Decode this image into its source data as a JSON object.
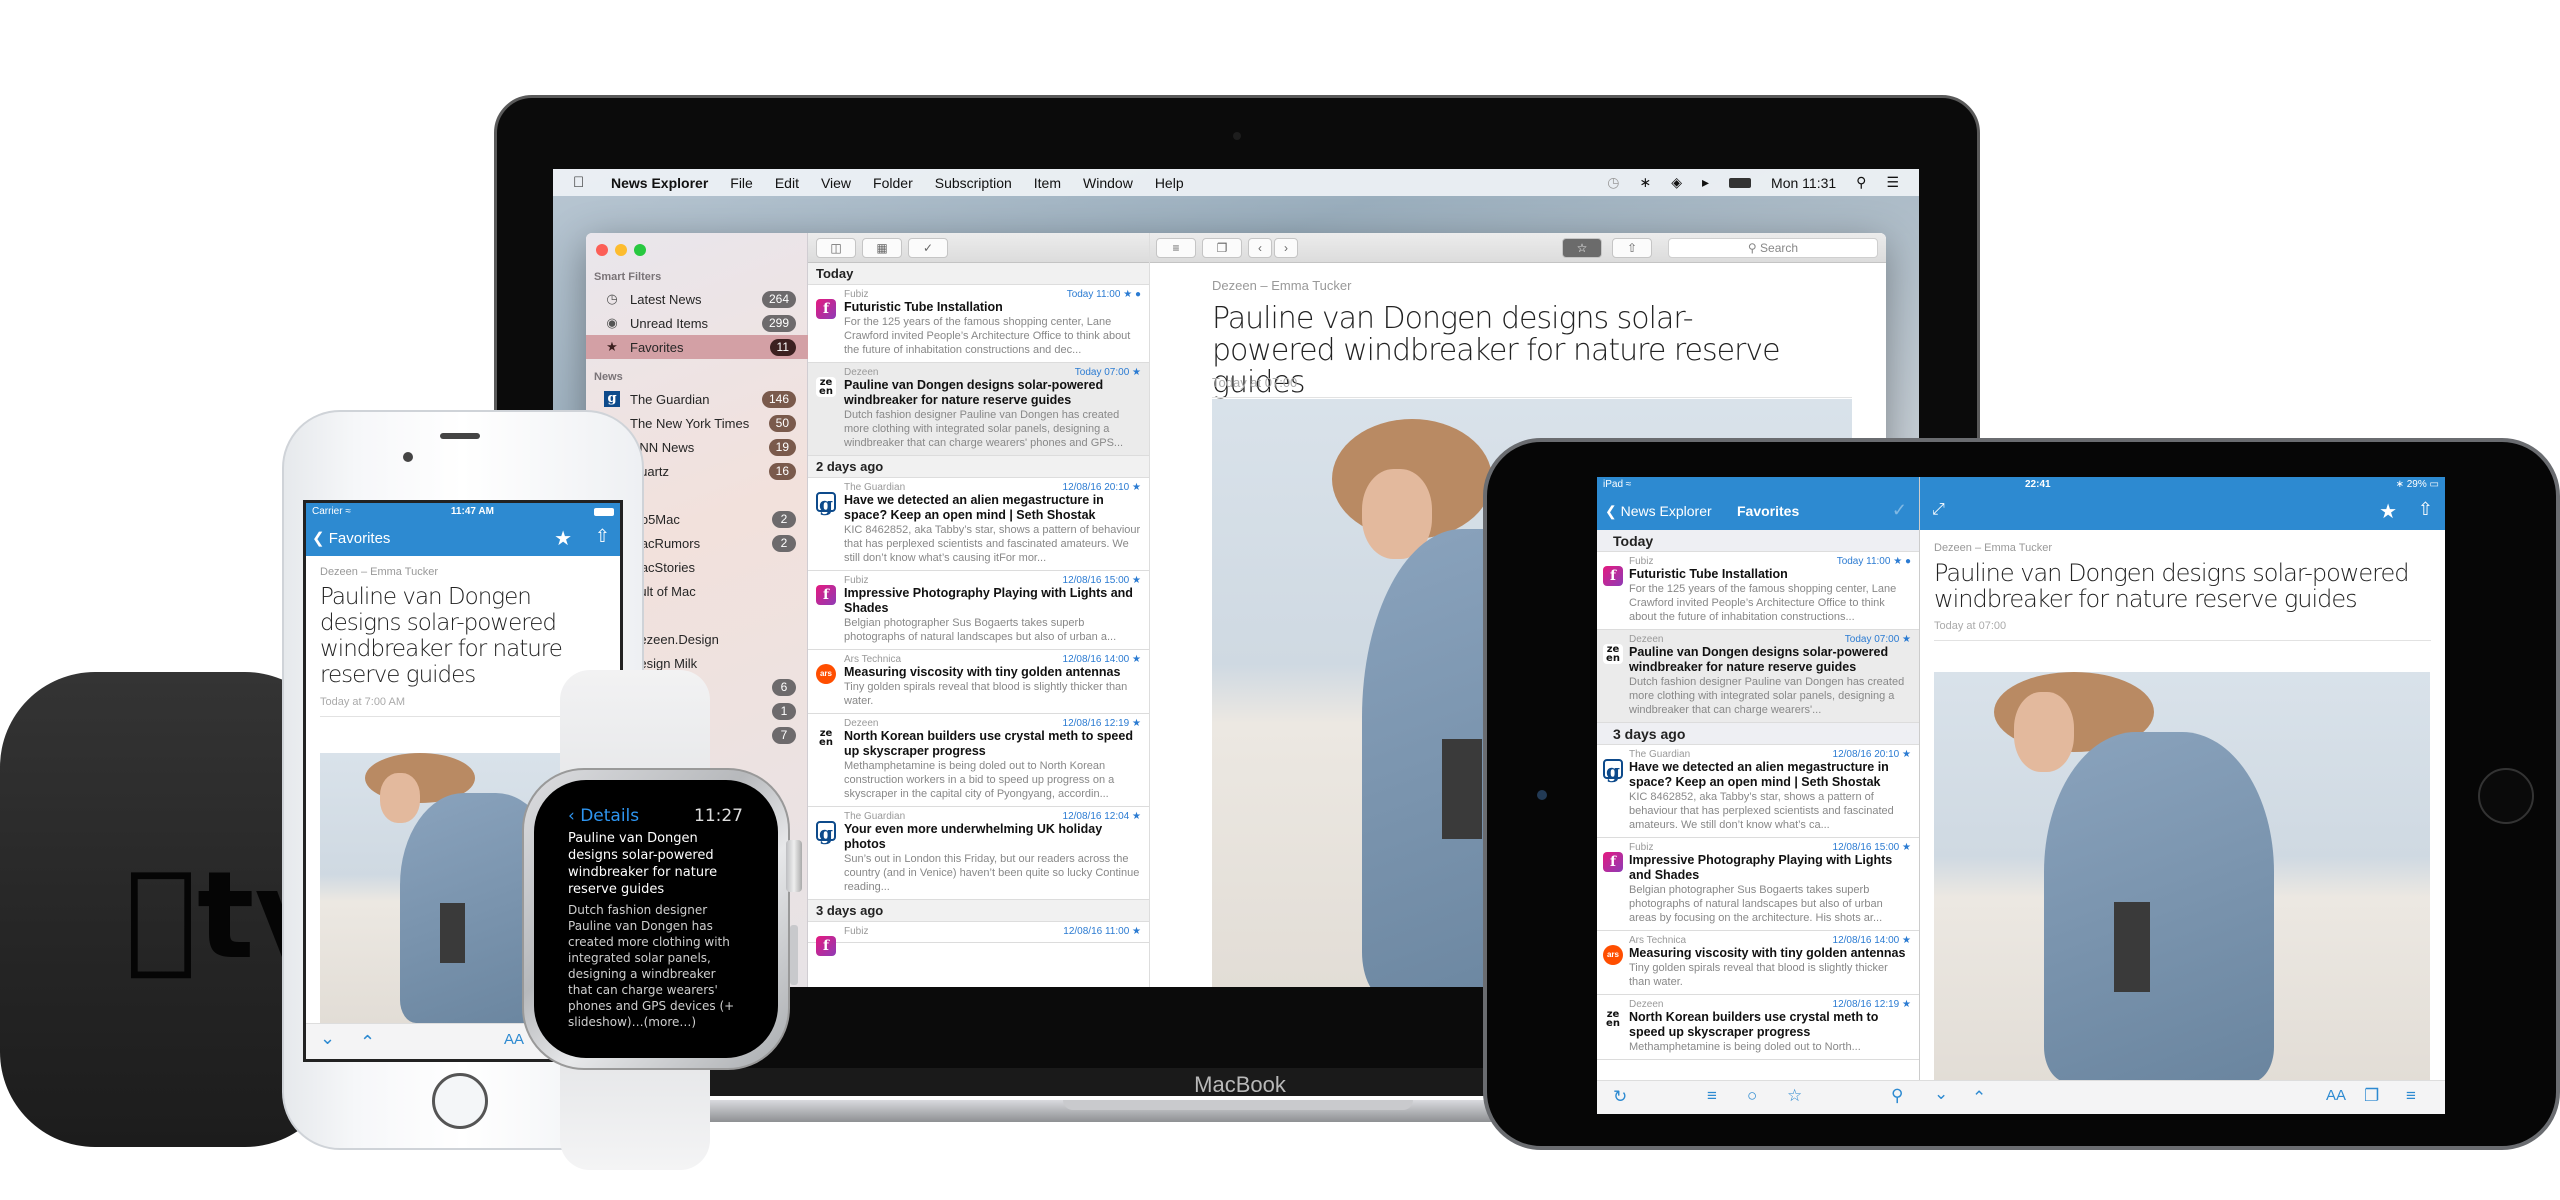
{
  "devices": {
    "apple_tv": {
      "logo_text": "tv"
    },
    "macbook": {
      "label": "MacBook"
    }
  },
  "mac": {
    "menubar": {
      "apple_icon": "apple-icon",
      "app_name": "News Explorer",
      "menus": [
        "File",
        "Edit",
        "View",
        "Folder",
        "Subscription",
        "Item",
        "Window",
        "Help"
      ],
      "status_icons": [
        "time-machine-icon",
        "bluetooth-icon",
        "wifi-icon",
        "volume-icon",
        "battery-icon"
      ],
      "clock": "Mon 11:31",
      "spotlight_icon": "search-icon",
      "notification_icon": "list-icon"
    },
    "sidebar": {
      "smart_filters_header": "Smart Filters",
      "smart_filters": [
        {
          "label": "Latest News",
          "count": "264",
          "icon": "clock-icon"
        },
        {
          "label": "Unread Items",
          "count": "299",
          "icon": "unread-icon"
        },
        {
          "label": "Favorites",
          "count": "11",
          "icon": "star-icon",
          "selected": true
        }
      ],
      "news_header": "News",
      "feeds": [
        {
          "label": "The Guardian",
          "count": "146"
        },
        {
          "label": "The New York Times",
          "count": "50"
        },
        {
          "label": "CNN News",
          "count": "19"
        },
        {
          "label": "Quartz",
          "count": "16"
        }
      ],
      "more_feeds": [
        {
          "label": "9to5Mac",
          "count": "2"
        },
        {
          "label": "MacRumors",
          "count": "2"
        },
        {
          "label": "MacStories",
          "count": ""
        },
        {
          "label": "Cult of Mac",
          "count": ""
        },
        {
          "label": "",
          "count": ""
        },
        {
          "label": "Dezeen.Design",
          "count": ""
        },
        {
          "label": "Design Milk",
          "count": ""
        },
        {
          "label": "",
          "count": "6"
        },
        {
          "label": "",
          "count": "1"
        },
        {
          "label": "",
          "count": "7"
        }
      ]
    },
    "list": {
      "sections": [
        {
          "title": "Today",
          "articles": [
            {
              "source": "Fubiz",
              "date": "Today 11:00 ★ ●",
              "title": "Futuristic Tube Installation",
              "summary": "For the 125 years of the famous shopping center, Lane Crawford invited People’s Architecture Office to think about the future of inhabitation constructions and dec...",
              "fav": "fubiz"
            },
            {
              "source": "Dezeen",
              "date": "Today 07:00 ★",
              "title": "Pauline van Dongen designs solar-powered windbreaker for nature reserve guides",
              "summary": "Dutch fashion designer Pauline van Dongen has created more clothing with integrated solar panels, designing a windbreaker that can charge wearers' phones and GPS...",
              "fav": "dezeen",
              "selected": true
            }
          ]
        },
        {
          "title": "2 days ago",
          "articles": [
            {
              "source": "The Guardian",
              "date": "12/08/16 20:10 ★",
              "title": "Have we detected an alien megastructure in space? Keep an open mind | Seth Shostak",
              "summary": "KIC 8462852, aka Tabby’s star, shows a pattern of behaviour that has perplexed scientists and fascinated amateurs. We still don’t know what’s causing itFor mor...",
              "fav": "guardian"
            },
            {
              "source": "Fubiz",
              "date": "12/08/16 15:00 ★",
              "title": "Impressive Photography Playing with Lights and Shades",
              "summary": "Belgian photographer Sus Bogaerts takes superb photographs of natural landscapes but also of urban a...",
              "fav": "fubiz"
            },
            {
              "source": "Ars Technica",
              "date": "12/08/16 14:00 ★",
              "title": "Measuring viscosity with tiny golden antennas",
              "summary": "Tiny golden spirals reveal that blood is slightly thicker than water.",
              "fav": "ars"
            },
            {
              "source": "Dezeen",
              "date": "12/08/16 12:19 ★",
              "title": "North Korean builders use crystal meth to speed up skyscraper progress",
              "summary": "Methamphetamine is being doled out to North Korean construction workers in a bid to speed up progress on a skyscraper in the capital city of Pyongyang, accordin...",
              "fav": "dezeen"
            },
            {
              "source": "The Guardian",
              "date": "12/08/16 12:04 ★",
              "title": "Your even more underwhelming UK holiday photos",
              "summary": "Sun’s out in London this Friday, but our readers across the country (and in Venice) haven’t been quite so lucky Continue reading...",
              "fav": "guardian"
            }
          ]
        },
        {
          "title": "3 days ago",
          "articles": [
            {
              "source": "Fubiz",
              "date": "12/08/16 11:00 ★",
              "title": "",
              "summary": "",
              "fav": "fubiz"
            }
          ]
        }
      ]
    },
    "reader": {
      "search_placeholder": "Search",
      "source": "Dezeen – Emma Tucker",
      "title": "Pauline van Dongen designs solar-powered windbreaker for nature reserve guides",
      "date": "Today at 07:00"
    }
  },
  "iphone": {
    "carrier": "Carrier",
    "time": "11:47 AM",
    "back_label": "Favorites",
    "source": "Dezeen – Emma Tucker",
    "title": "Pauline van Dongen designs solar-powered windbreaker for nature reserve guides",
    "date": "Today at 7:00 AM",
    "font_button": "AA"
  },
  "watch": {
    "back_label": "Details",
    "time": "11:27",
    "title": "Pauline van Dongen designs solar-powered windbreaker for nature reserve guides",
    "body": "Dutch fashion designer Pauline van Dongen has created more clothing with integrated solar panels, designing a windbreaker that can charge wearers' phones and GPS devices (+ slideshow)…(more…)"
  },
  "ipad": {
    "status_left": "iPad",
    "time": "22:41",
    "battery": "29%",
    "back_label": "News Explorer",
    "list_title": "Favorites",
    "sections": [
      {
        "title": "Today",
        "articles": [
          {
            "source": "Fubiz",
            "date": "Today 11:00 ★ ●",
            "title": "Futuristic Tube Installation",
            "summary": "For the 125 years of the famous shopping center, Lane Crawford invited People’s Architecture Office to think about the future of inhabitation constructions...",
            "fav": "fubiz"
          },
          {
            "source": "Dezeen",
            "date": "Today 07:00 ★",
            "title": "Pauline van Dongen designs solar-powered windbreaker for nature reserve guides",
            "summary": "Dutch fashion designer Pauline van Dongen has created more clothing with integrated solar panels, designing a windbreaker that can charge wearers'...",
            "fav": "dezeen",
            "selected": true
          }
        ]
      },
      {
        "title": "3 days ago",
        "articles": [
          {
            "source": "The Guardian",
            "date": "12/08/16 20:10 ★",
            "title": "Have we detected an alien megastructure in space? Keep an open mind | Seth Shostak",
            "summary": "KIC 8462852, aka Tabby’s star, shows a pattern of behaviour that has perplexed scientists and fascinated amateurs. We still don’t know what’s ca...",
            "fav": "guardian"
          },
          {
            "source": "Fubiz",
            "date": "12/08/16 15:00 ★",
            "title": "Impressive Photography Playing with Lights and Shades",
            "summary": "Belgian photographer Sus Bogaerts takes superb photographs of natural landscapes but also of urban areas by focusing on the architecture. His shots ar...",
            "fav": "fubiz"
          },
          {
            "source": "Ars Technica",
            "date": "12/08/16 14:00 ★",
            "title": "Measuring viscosity with tiny golden antennas",
            "summary": "Tiny golden spirals reveal that blood is slightly thicker than water.",
            "fav": "ars"
          },
          {
            "source": "Dezeen",
            "date": "12/08/16 12:19 ★",
            "title": "North Korean builders use crystal meth to speed up skyscraper progress",
            "summary": "Methamphetamine is being doled out to North...",
            "fav": "dezeen"
          }
        ]
      }
    ],
    "reader": {
      "source": "Dezeen – Emma Tucker",
      "title": "Pauline van Dongen designs solar-powered windbreaker for nature reserve guides",
      "date": "Today at 07:00",
      "font_button": "AA"
    }
  },
  "colors": {
    "accent_blue": "#2d8ad1",
    "selection_pink": "#d3a0a5",
    "fubiz": "#c9238f",
    "ars": "#ff4e00",
    "guardian": "#0d4a8b"
  }
}
